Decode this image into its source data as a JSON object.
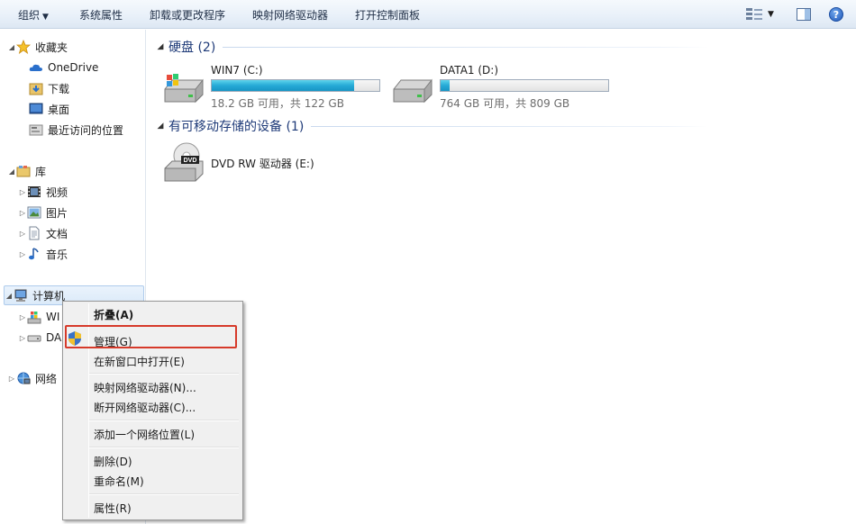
{
  "toolbar": {
    "organize": "组织",
    "system_properties": "系统属性",
    "uninstall": "卸载或更改程序",
    "map_drive": "映射网络驱动器",
    "open_control_panel": "打开控制面板",
    "help": "?"
  },
  "nav": {
    "favorites": "收藏夹",
    "onedrive": "OneDrive",
    "downloads": "下载",
    "desktop": "桌面",
    "recent": "最近访问的位置",
    "libraries": "库",
    "videos": "视频",
    "pictures": "图片",
    "documents": "文档",
    "music": "音乐",
    "computer": "计算机",
    "computer_sub1": "WI",
    "computer_sub2": "DA",
    "network": "网络"
  },
  "content": {
    "hard_disks_header": "硬盘 (2)",
    "removable_header": "有可移动存储的设备 (1)",
    "drives": [
      {
        "name": "WIN7 (C:)",
        "free_text": "18.2 GB 可用，共 122 GB",
        "used_fraction": 0.851
      },
      {
        "name": "DATA1 (D:)",
        "free_text": "764 GB 可用，共 809 GB",
        "used_fraction": 0.056
      }
    ],
    "dvd": {
      "name": "DVD RW 驱动器 (E:)",
      "label": "DVD"
    }
  },
  "context_menu": {
    "collapse": "折叠(A)",
    "manage": "管理(G)",
    "open_new_window": "在新窗口中打开(E)",
    "map_network_drive": "映射网络驱动器(N)...",
    "disconnect_network_drive": "断开网络驱动器(C)...",
    "add_network_location": "添加一个网络位置(L)",
    "delete": "删除(D)",
    "rename": "重命名(M)",
    "properties": "属性(R)"
  },
  "colors": {
    "accent_blue": "#1e3a78",
    "drive_bar": "#26a9d6",
    "highlight_red": "#d63a2a"
  }
}
